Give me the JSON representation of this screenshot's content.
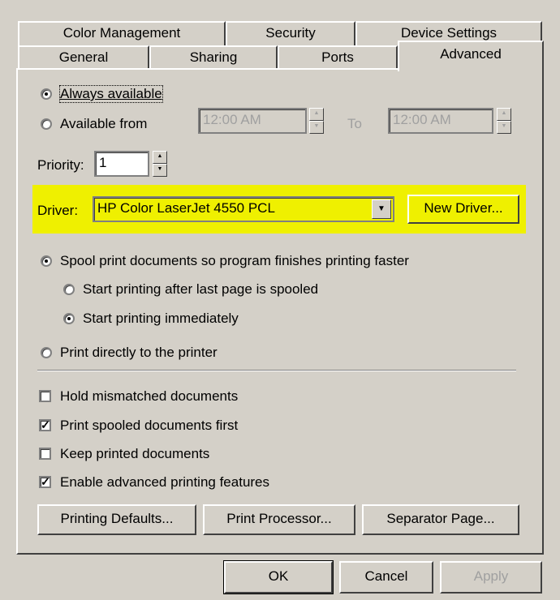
{
  "tabs_back": [
    "Color Management",
    "Security",
    "Device Settings"
  ],
  "tabs_front": [
    "General",
    "Sharing",
    "Ports",
    "Advanced"
  ],
  "availability": {
    "always_label": "Always available",
    "from_label": "Available from",
    "from_time": "12:00 AM",
    "to_label": "To",
    "to_time": "12:00 AM"
  },
  "priority": {
    "label": "Priority:",
    "value": "1"
  },
  "driver": {
    "label": "Driver:",
    "value": "HP Color LaserJet 4550 PCL",
    "new_driver_button": "New Driver...",
    "highlight_color": "#eff000"
  },
  "spool": {
    "spool_label": "Spool print documents so program finishes printing faster",
    "after_last_label": "Start printing after last page is spooled",
    "immediately_label": "Start printing immediately",
    "direct_label": "Print directly to the printer"
  },
  "options": {
    "hold_label": "Hold mismatched documents",
    "hold_checked": false,
    "spooled_first_label": "Print spooled documents first",
    "spooled_first_checked": true,
    "keep_label": "Keep printed documents",
    "keep_checked": false,
    "advanced_label": "Enable advanced printing features",
    "advanced_checked": true
  },
  "buttons": {
    "printing_defaults": "Printing Defaults...",
    "print_processor": "Print Processor...",
    "separator_page": "Separator Page...",
    "ok": "OK",
    "cancel": "Cancel",
    "apply": "Apply"
  }
}
